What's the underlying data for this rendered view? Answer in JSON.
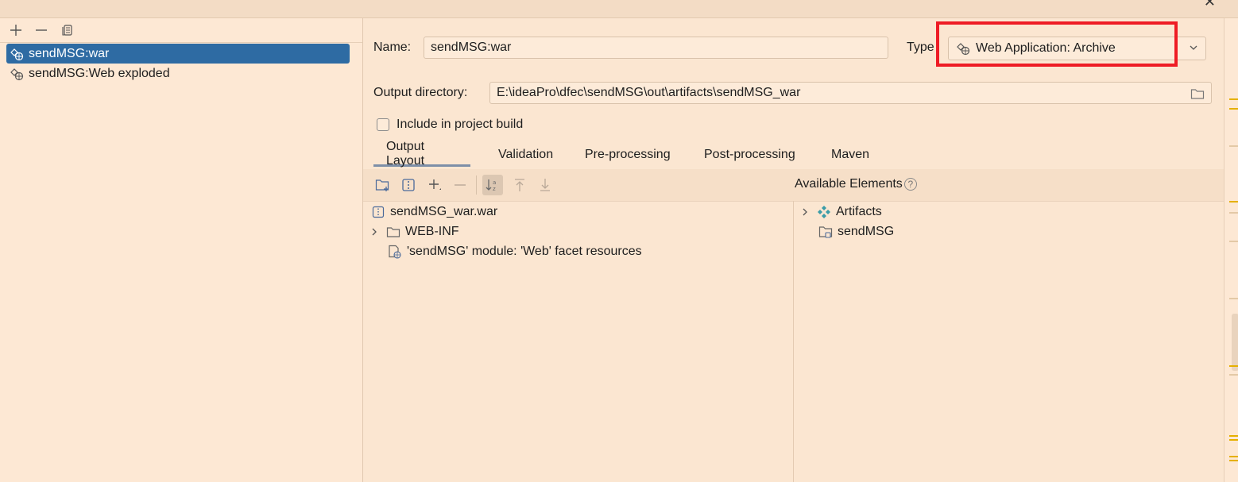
{
  "window": {
    "close_glyph": "✕"
  },
  "left_toolbar": {
    "add_icon": "plus-icon",
    "remove_icon": "minus-icon",
    "copy_icon": "copy-icon"
  },
  "artifacts": [
    {
      "label": "sendMSG:war",
      "selected": true
    },
    {
      "label": "sendMSG:Web exploded",
      "selected": false
    }
  ],
  "form": {
    "name_label": "Name:",
    "name_value": "sendMSG:war",
    "type_label": "Type",
    "type_value": "Web Application: Archive",
    "output_dir_label": "Output directory:",
    "output_dir_value": "E:\\ideaPro\\dfec\\sendMSG\\out\\artifacts\\sendMSG_war",
    "include_label": "Include in project build",
    "include_checked": false
  },
  "tabs": [
    {
      "label": "Output Layout",
      "active": true
    },
    {
      "label": "Validation",
      "active": false
    },
    {
      "label": "Pre-processing",
      "active": false
    },
    {
      "label": "Post-processing",
      "active": false
    },
    {
      "label": "Maven",
      "active": false
    }
  ],
  "output_layout": {
    "items": [
      {
        "label": "sendMSG_war.war",
        "icon": "archive-icon"
      },
      {
        "label": "WEB-INF",
        "icon": "folder-icon",
        "expandable": true
      },
      {
        "label": "'sendMSG' module: 'Web' facet resources",
        "icon": "web-facet-icon"
      }
    ]
  },
  "available": {
    "title": "Available Elements",
    "help": "?",
    "items": [
      {
        "label": "Artifacts",
        "icon": "artifacts-icon",
        "expandable": true
      },
      {
        "label": "sendMSG",
        "icon": "module-folder-icon"
      }
    ]
  },
  "colors": {
    "selection": "#2e6ba3",
    "highlight_box": "#ee1c25",
    "background": "#fbe6d1",
    "marker": "#e5b000"
  }
}
